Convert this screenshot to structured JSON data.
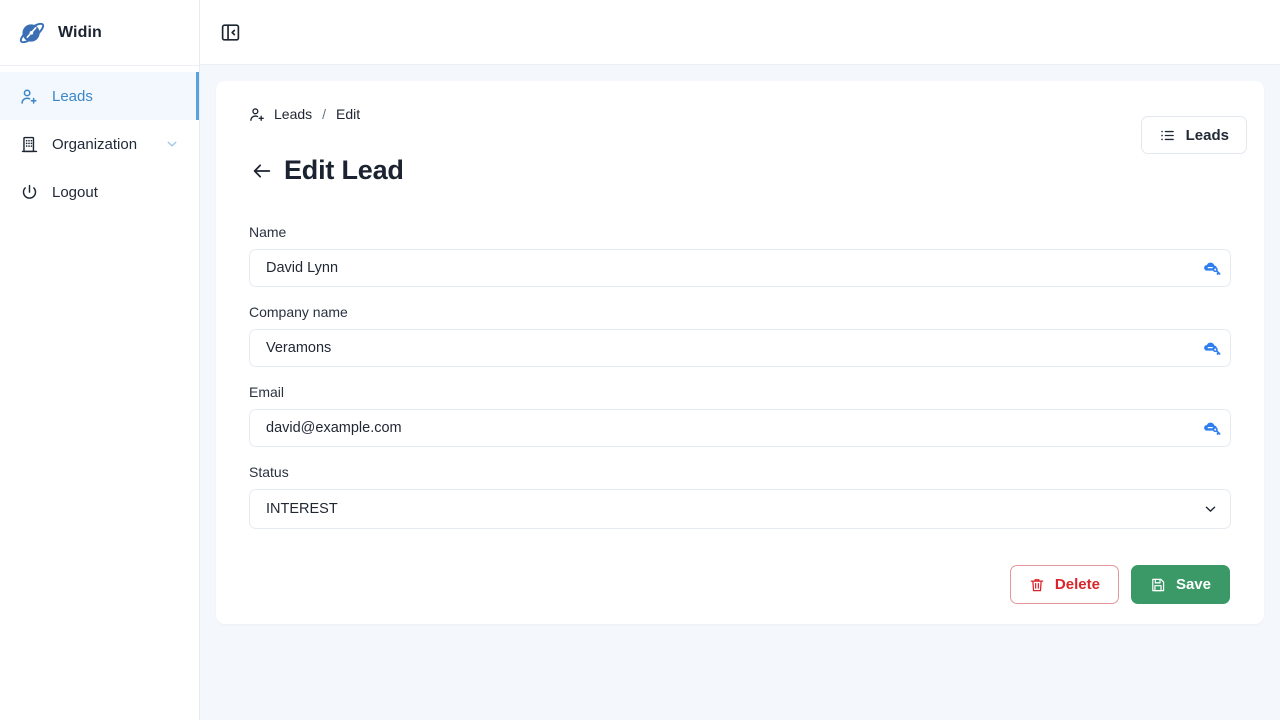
{
  "brand": {
    "name": "Widin",
    "logo_icon": "planet-icon",
    "logo_color": "#3a6fb5"
  },
  "sidebar": {
    "items": [
      {
        "id": "leads",
        "label": "Leads",
        "icon": "user-plus-icon",
        "active": true,
        "has_caret": false
      },
      {
        "id": "organization",
        "label": "Organization",
        "icon": "building-icon",
        "active": false,
        "has_caret": true
      },
      {
        "id": "logout",
        "label": "Logout",
        "icon": "power-icon",
        "active": false,
        "has_caret": false
      }
    ],
    "active_color": "#3b86c8",
    "active_bg": "#f2f8fd"
  },
  "topbar": {
    "collapse_icon": "panel-collapse-icon"
  },
  "breadcrumb": {
    "icon": "user-plus-icon",
    "items": [
      "Leads",
      "Edit"
    ],
    "separator": "/"
  },
  "header": {
    "back_icon": "arrow-left-icon",
    "title": "Edit Lead",
    "leads_button": {
      "label": "Leads",
      "icon": "list-icon"
    }
  },
  "form": {
    "fields": [
      {
        "id": "name",
        "label": "Name",
        "type": "text",
        "value": "David Lynn",
        "placeholder": "Name",
        "trailing_icon": "password-autofill-icon"
      },
      {
        "id": "company_name",
        "label": "Company name",
        "type": "text",
        "value": "Veramons",
        "placeholder": "Company name",
        "trailing_icon": "password-autofill-icon"
      },
      {
        "id": "email",
        "label": "Email",
        "type": "text",
        "value": "david@example.com",
        "placeholder": "Email",
        "trailing_icon": "password-autofill-icon"
      },
      {
        "id": "status",
        "label": "Status",
        "type": "select",
        "value": "INTEREST",
        "caret_icon": "chevron-down-icon"
      }
    ]
  },
  "actions": {
    "delete": {
      "label": "Delete",
      "icon": "trash-icon",
      "color": "#d9252a"
    },
    "save": {
      "label": "Save",
      "icon": "save-disk-icon",
      "color": "#3a9966"
    }
  }
}
